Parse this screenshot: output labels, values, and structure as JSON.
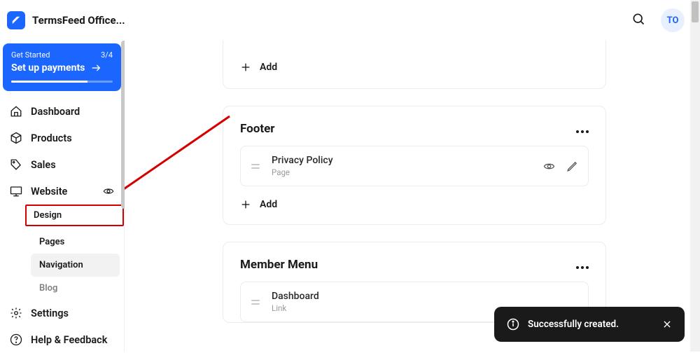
{
  "header": {
    "app_title": "TermsFeed Office...",
    "avatar_initials": "TO"
  },
  "sidebar": {
    "get_started": {
      "label": "Get Started",
      "progress": "3/4",
      "cta": "Set up payments"
    },
    "items": {
      "dashboard": "Dashboard",
      "products": "Products",
      "sales": "Sales",
      "website": "Website",
      "settings": "Settings",
      "help": "Help & Feedback"
    },
    "website_sub": {
      "design": "Design",
      "pages": "Pages",
      "navigation": "Navigation",
      "blog": "Blog"
    }
  },
  "main": {
    "add_label": "Add",
    "sections": {
      "footer": {
        "title": "Footer",
        "item": {
          "title": "Privacy Policy",
          "type": "Page"
        }
      },
      "member": {
        "title": "Member Menu",
        "item": {
          "title": "Dashboard",
          "type": "Link"
        }
      }
    }
  },
  "toast": {
    "message": "Successfully created."
  }
}
